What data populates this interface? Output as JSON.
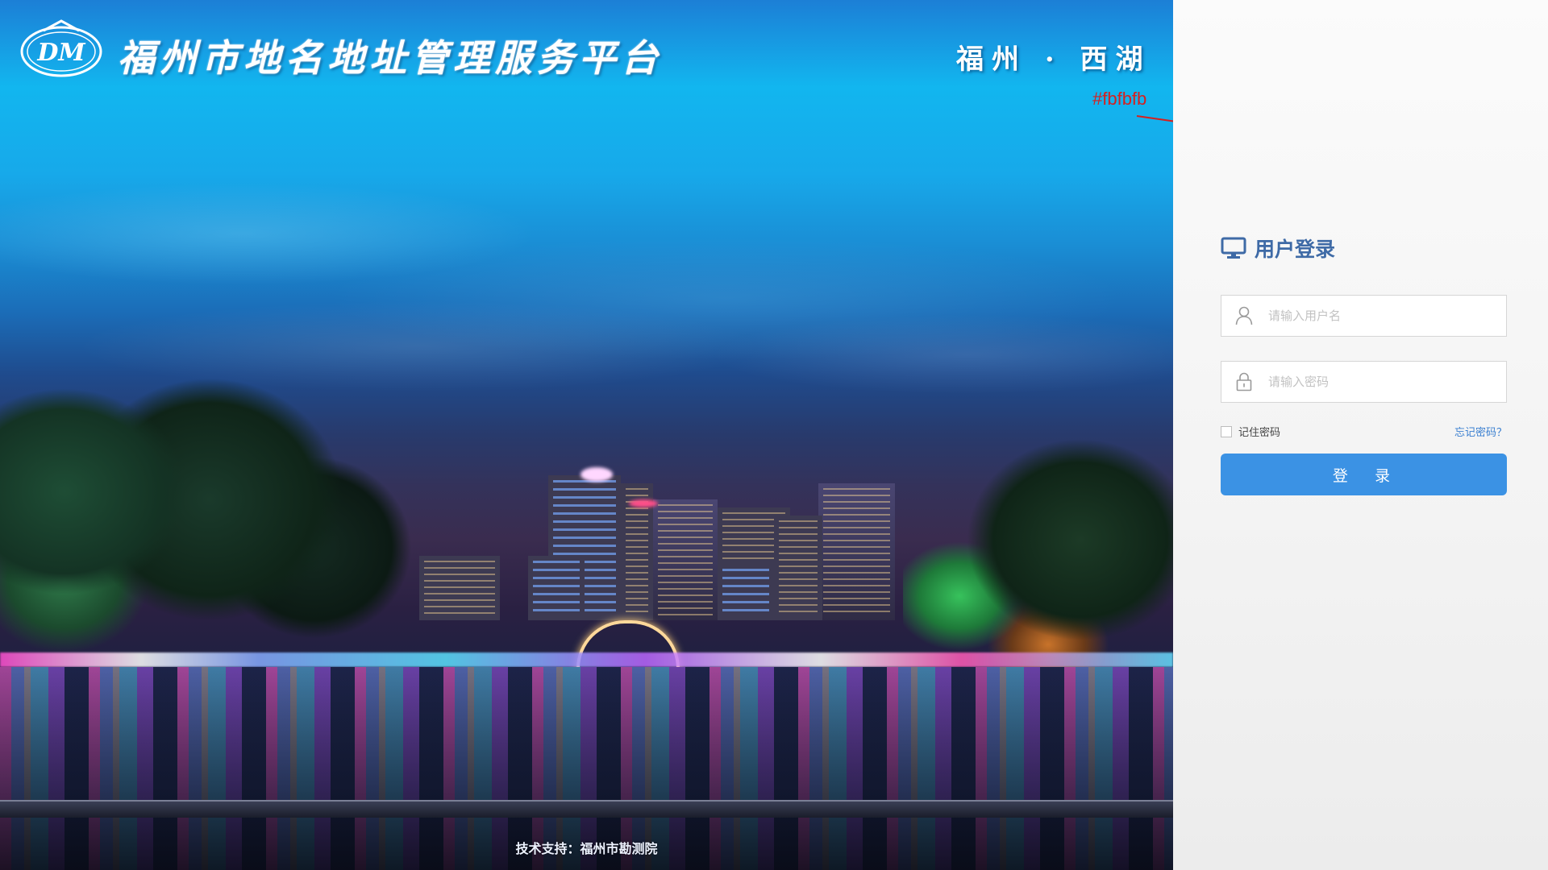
{
  "header": {
    "site_title": "福州市地名地址管理服务平台",
    "place_title": "福州 · 西湖",
    "logo_letters": "DM"
  },
  "annotation": {
    "text": "#fbfbfb",
    "color": "#d6201f"
  },
  "footer": {
    "support": "技术支持：福州市勘测院"
  },
  "login": {
    "title": "用户登录",
    "title_icon": "monitor-icon",
    "username_placeholder": "请输入用户名",
    "username_icon": "user-icon",
    "password_placeholder": "请输入密码",
    "password_icon": "lock-icon",
    "remember_label": "记住密码",
    "forgot_label": "忘记密码？",
    "submit_label": "登 录"
  },
  "colors": {
    "panel_bg": "#fbfbfb",
    "title_color": "#3e6aa6",
    "button_bg": "#3b92e4",
    "link_color": "#3a7fd0"
  }
}
